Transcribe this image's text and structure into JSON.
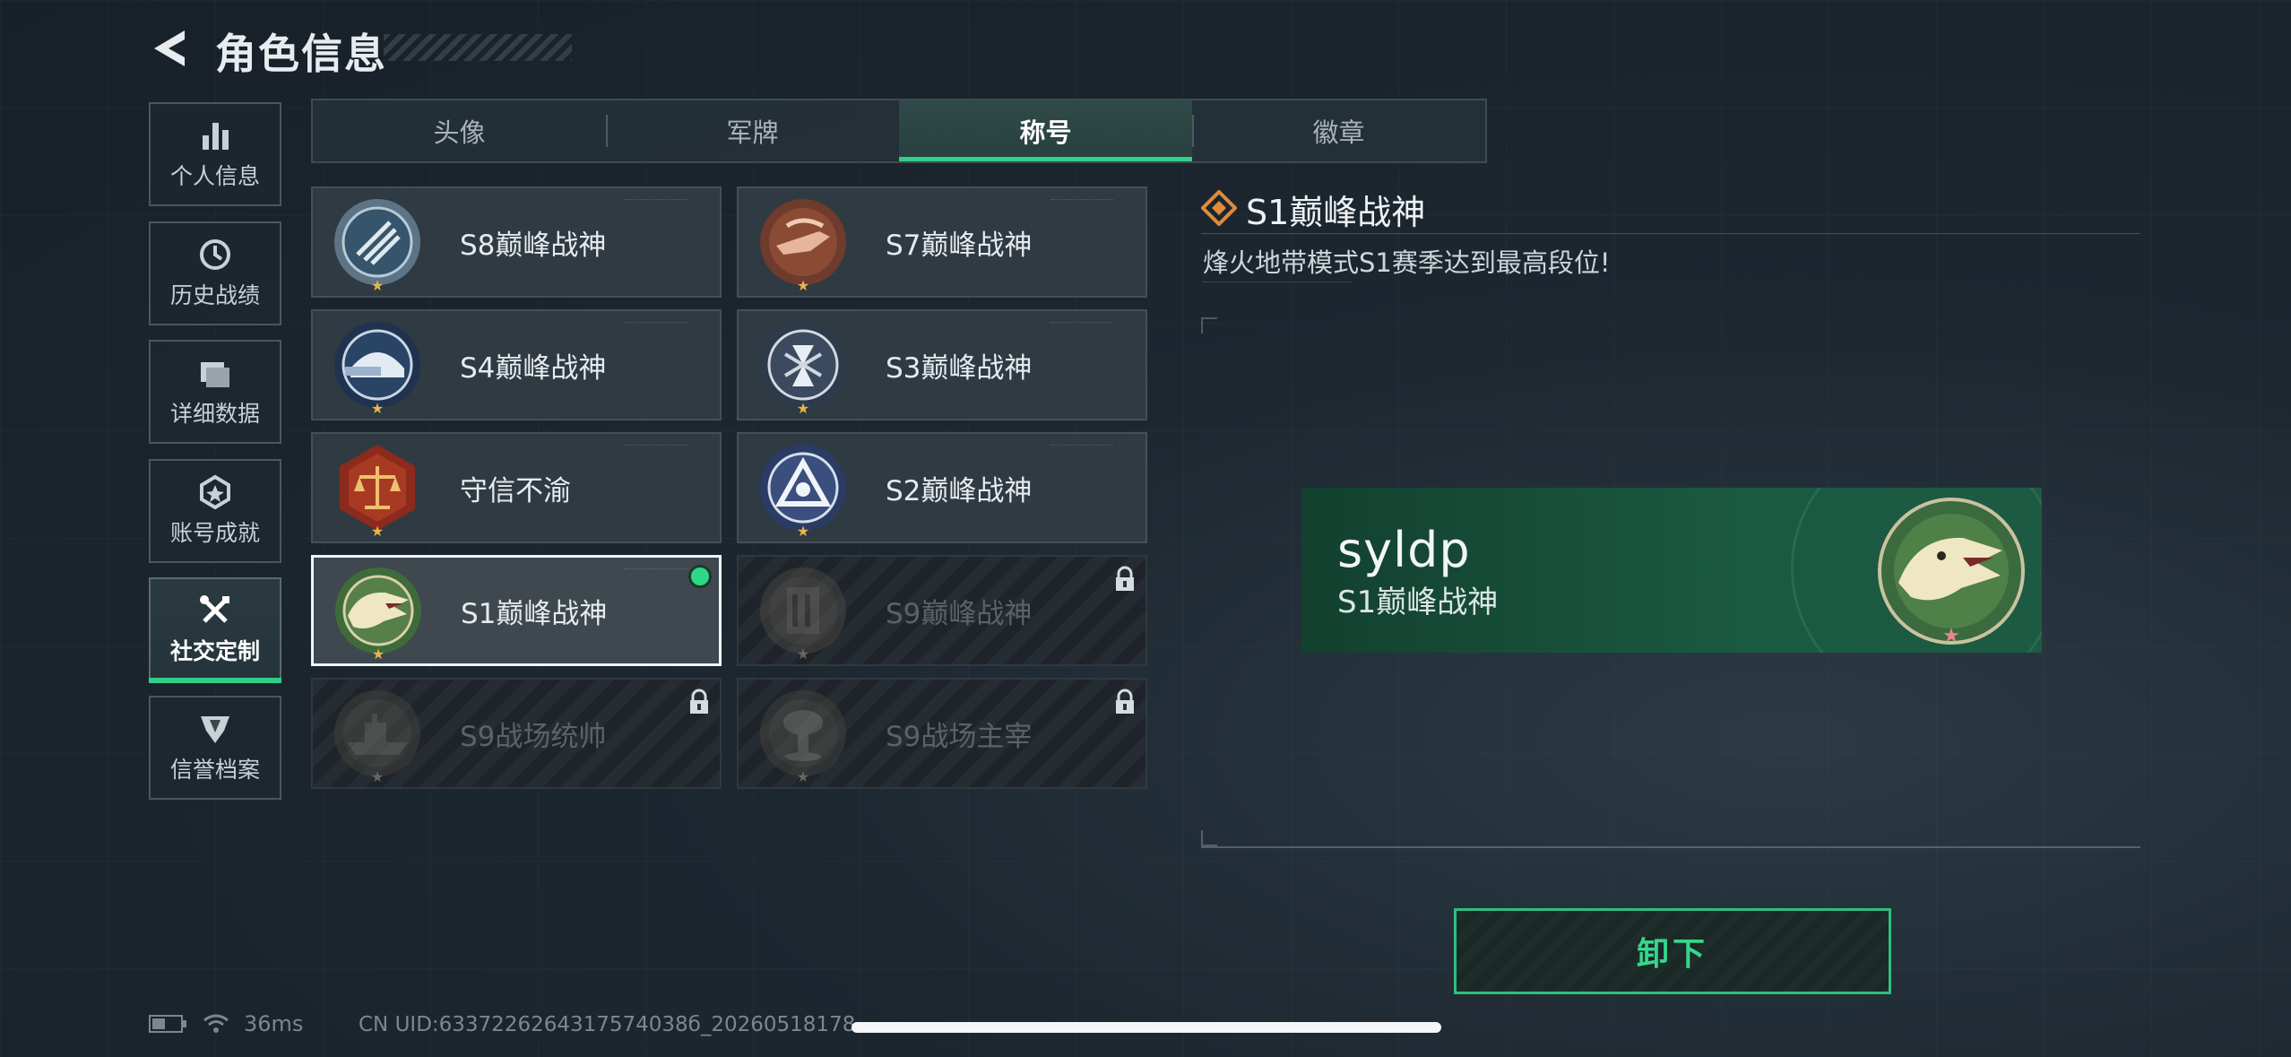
{
  "header": {
    "title": "角色信息"
  },
  "sidebar": {
    "items": [
      {
        "label": "个人信息",
        "icon": "bar-chart-icon"
      },
      {
        "label": "历史战绩",
        "icon": "history-icon"
      },
      {
        "label": "详细数据",
        "icon": "folder-icon"
      },
      {
        "label": "账号成就",
        "icon": "achievement-icon"
      },
      {
        "label": "社交定制",
        "icon": "tools-icon",
        "active": true
      },
      {
        "label": "信誉档案",
        "icon": "reputation-icon"
      }
    ]
  },
  "tabs": [
    {
      "label": "头像"
    },
    {
      "label": "军牌"
    },
    {
      "label": "称号",
      "active": true
    },
    {
      "label": "徽章"
    }
  ],
  "titles": [
    {
      "name": "S8巅峰战神",
      "state": "unlocked"
    },
    {
      "name": "S7巅峰战神",
      "state": "unlocked"
    },
    {
      "name": "S4巅峰战神",
      "state": "unlocked"
    },
    {
      "name": "S3巅峰战神",
      "state": "unlocked"
    },
    {
      "name": "守信不渝",
      "state": "unlocked"
    },
    {
      "name": "S2巅峰战神",
      "state": "unlocked"
    },
    {
      "name": "S1巅峰战神",
      "state": "selected-equipped"
    },
    {
      "name": "S9巅峰战神",
      "state": "locked"
    },
    {
      "name": "S9战场统帅",
      "state": "locked"
    },
    {
      "name": "S9战场主宰",
      "state": "locked"
    }
  ],
  "detail": {
    "title": "S1巅峰战神",
    "description": "烽火地带模式S1赛季达到最高段位!"
  },
  "preview": {
    "player_name": "syldp",
    "title": "S1巅峰战神"
  },
  "actions": {
    "unequip_label": "卸下"
  },
  "status_bar": {
    "latency": "36ms",
    "uid": "CN UID:6337226264317574038б_20260518178"
  },
  "colors": {
    "accent": "#2fcf86",
    "background": "#1d2730"
  }
}
